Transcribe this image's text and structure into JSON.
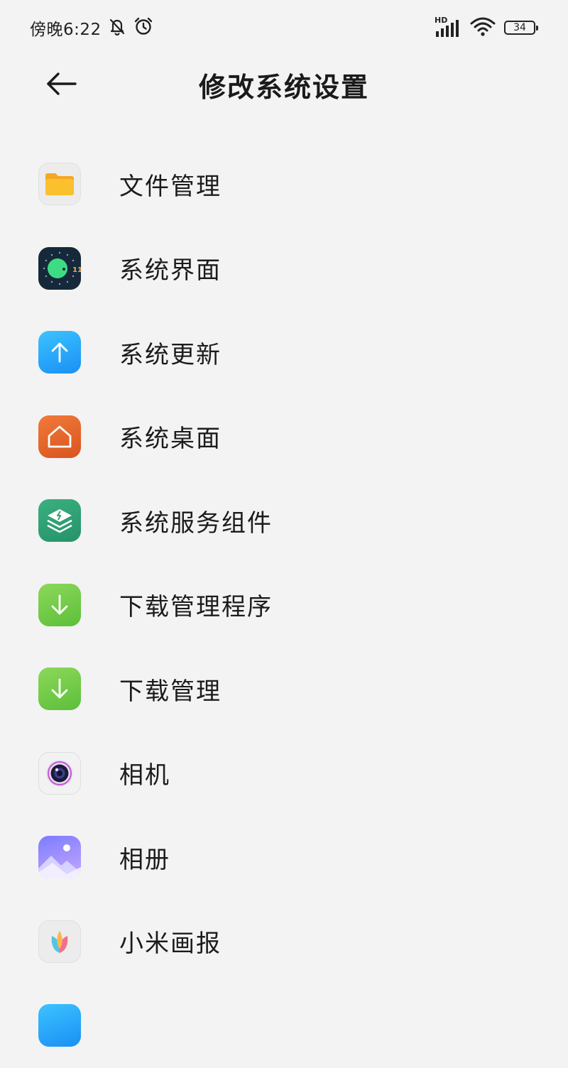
{
  "status_bar": {
    "time": "傍晚6:22",
    "network_label": "HD",
    "battery_level": "34",
    "icons": [
      "bell-off-icon",
      "alarm-icon",
      "signal-icon",
      "wifi-icon",
      "battery-icon"
    ]
  },
  "header": {
    "title": "修改系统设置",
    "back_icon": "arrow-left-icon"
  },
  "apps": [
    {
      "label": "文件管理",
      "icon": "folder-icon",
      "color": "#f7b32b"
    },
    {
      "label": "系统界面",
      "icon": "system-ui-icon",
      "color": "#15293a"
    },
    {
      "label": "系统更新",
      "icon": "arrow-up-icon",
      "color": "#1a9bf7"
    },
    {
      "label": "系统桌面",
      "icon": "home-icon",
      "color": "#e0622a"
    },
    {
      "label": "系统服务组件",
      "icon": "layers-icon",
      "color": "#2fa374"
    },
    {
      "label": "下载管理程序",
      "icon": "download-icon",
      "color": "#6cc843"
    },
    {
      "label": "下载管理",
      "icon": "download-icon",
      "color": "#6cc843"
    },
    {
      "label": "相机",
      "icon": "camera-lens-icon",
      "color": "#3a2a6a"
    },
    {
      "label": "相册",
      "icon": "gallery-icon",
      "color": "#8b86ff"
    },
    {
      "label": "小米画报",
      "icon": "tulip-icon",
      "color": "#f08bb0"
    }
  ],
  "colors": {
    "background": "#f3f3f3",
    "text": "#1c1c1c"
  }
}
